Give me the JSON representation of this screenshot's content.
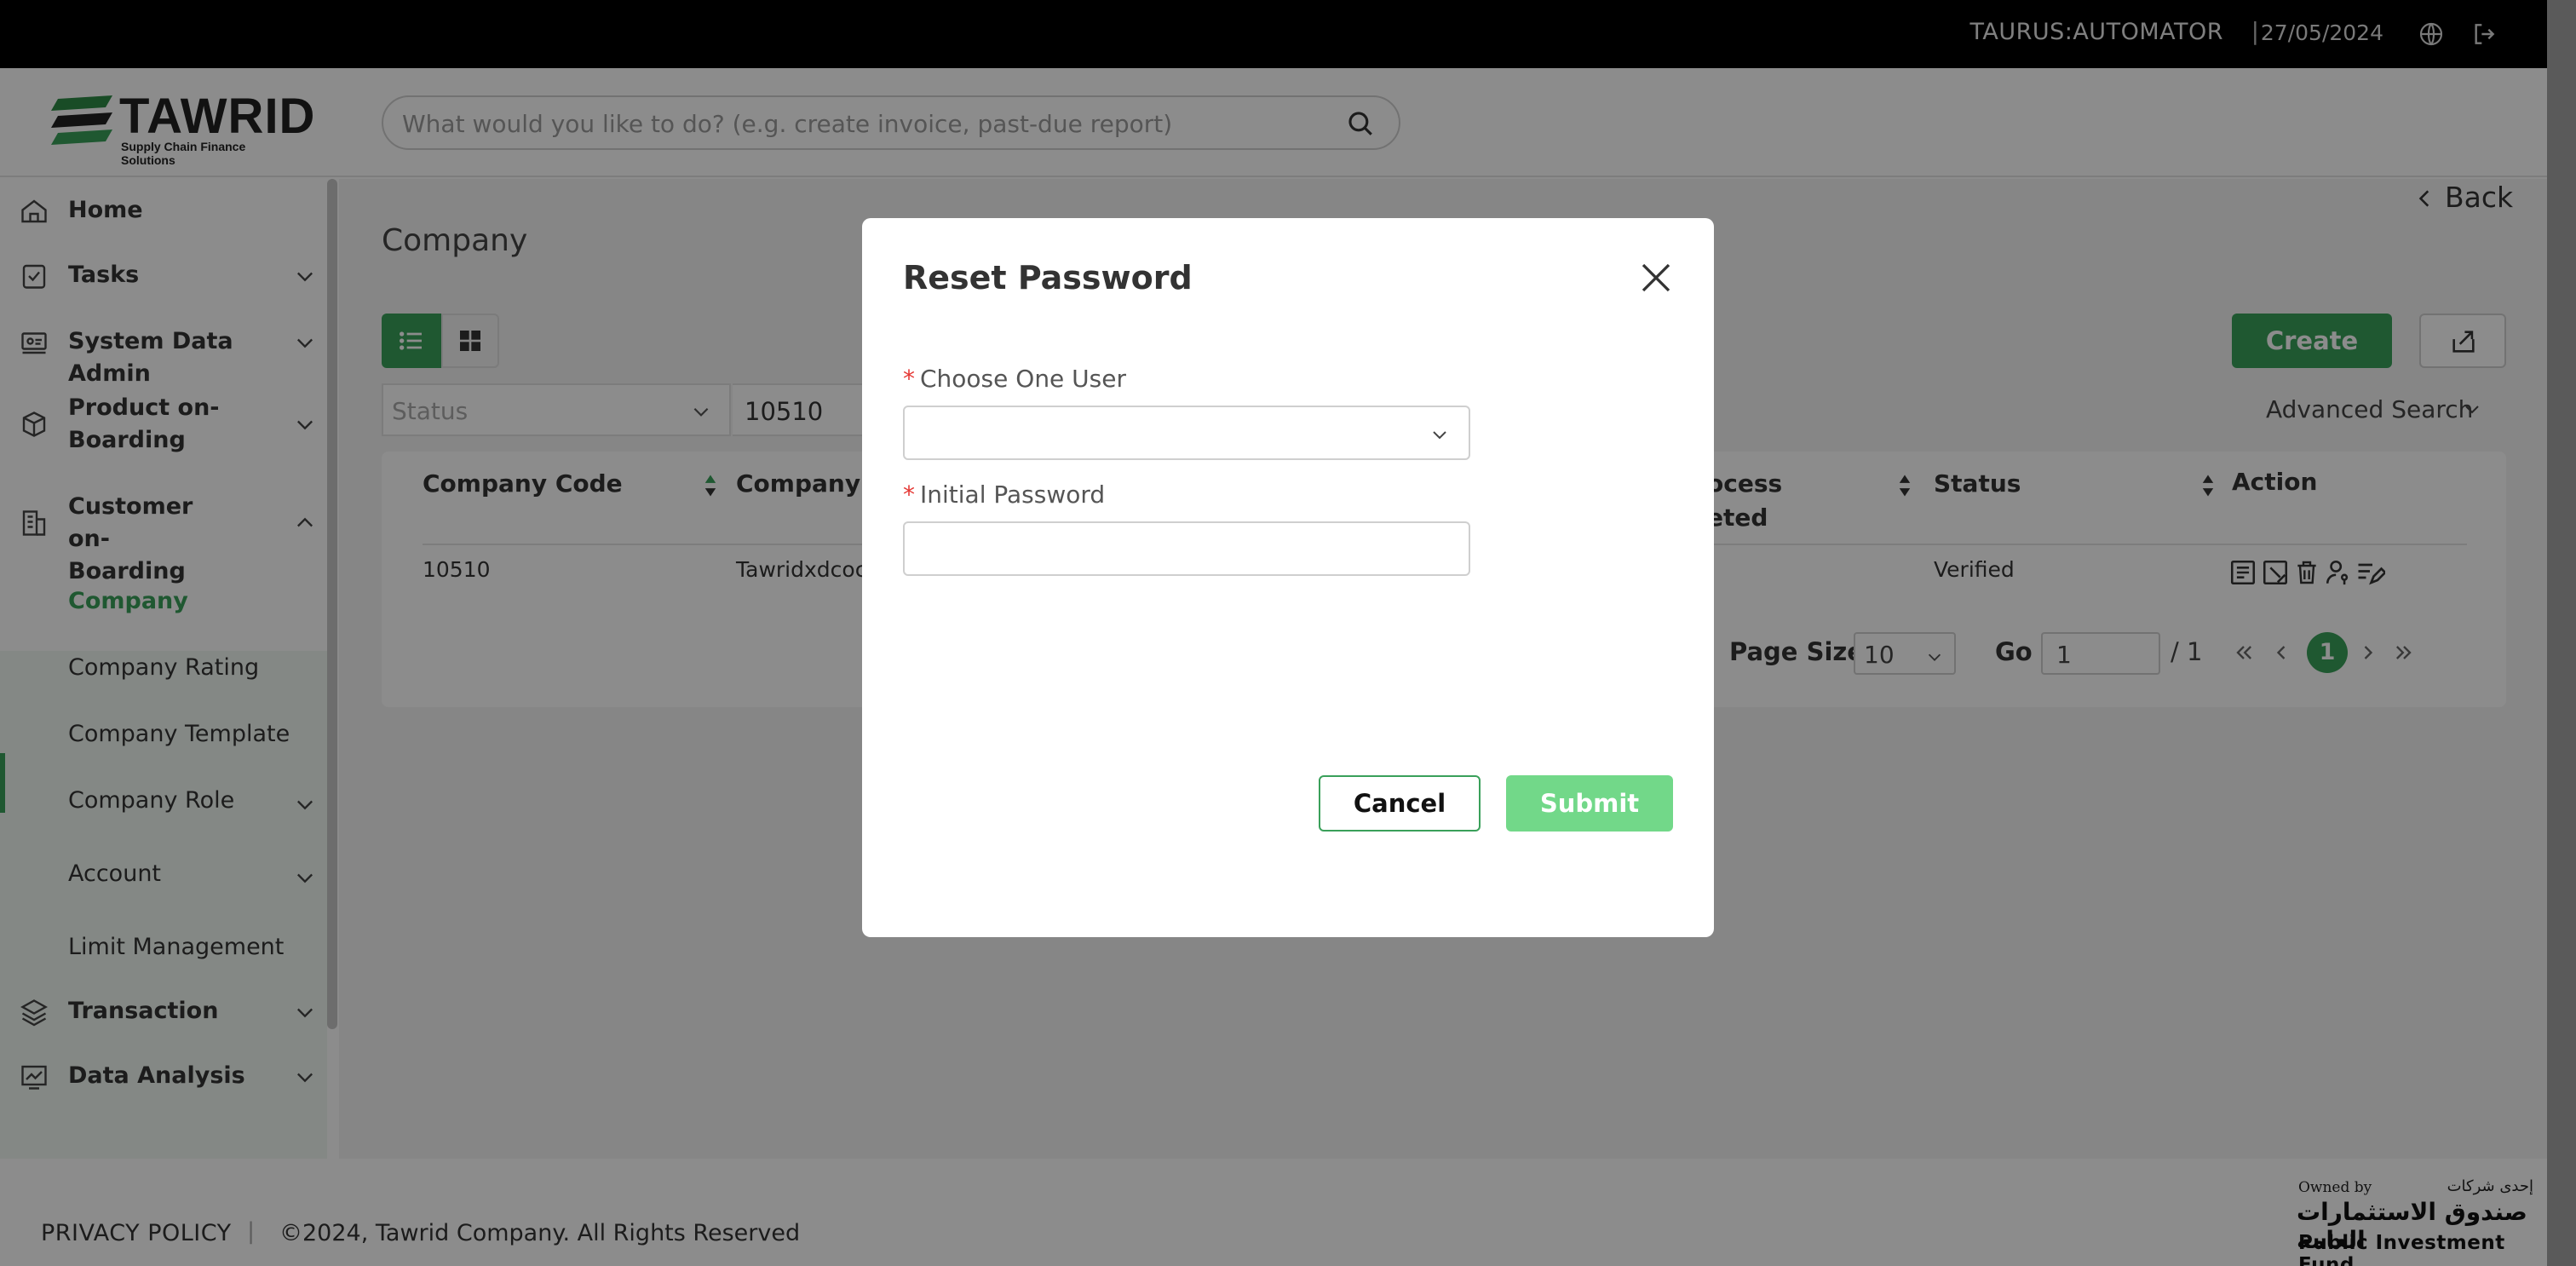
{
  "topbar": {
    "user": "TAURUS:AUTOMATOR",
    "separator": "|",
    "date": "27/05/2024"
  },
  "header": {
    "logo_text": "TAWRID",
    "logo_tagline": "Supply Chain Finance Solutions",
    "search_placeholder": "What would you like to do? (e.g. create invoice, past-due report)"
  },
  "sidebar": {
    "items": [
      {
        "label": "Home",
        "icon": "home-icon"
      },
      {
        "label": "Tasks",
        "icon": "tasks-icon"
      },
      {
        "label": "System Data Admin",
        "icon": "admin-icon"
      },
      {
        "label": "Product on-Boarding",
        "icon": "package-icon"
      },
      {
        "label": "Customer on-Boarding",
        "icon": "building-icon"
      },
      {
        "label": "Transaction",
        "icon": "layers-icon"
      },
      {
        "label": "Data Analysis",
        "icon": "chart-icon"
      }
    ],
    "subitems": [
      {
        "label": "Company",
        "active": true
      },
      {
        "label": "Company Rating"
      },
      {
        "label": "Company Template"
      },
      {
        "label": "Company Role"
      },
      {
        "label": "Account"
      },
      {
        "label": "Limit Management"
      }
    ]
  },
  "main": {
    "title": "Company",
    "back_label": "Back",
    "create_label": "Create",
    "status_placeholder": "Status",
    "code_filter_value": "10510",
    "advanced_search_label": "Advanced Search",
    "table": {
      "headers": [
        "Company Code",
        "Company N",
        "ocess\neted",
        "Status",
        "Action"
      ],
      "rows": [
        {
          "code": "10510",
          "name": "Tawridxdcocxo",
          "status": "Verified"
        }
      ]
    },
    "pager": {
      "page_size_label": "Page Size",
      "page_size_value": "10",
      "go_label": "Go",
      "go_value": "1",
      "total": "/ 1",
      "current": "1"
    }
  },
  "footer": {
    "privacy": "PRIVACY POLICY",
    "separator": "|",
    "copyright": "©2024, Tawrid Company. All Rights Reserved",
    "owned_by": "Owned by",
    "owned_by_ar": "إحدى شركات",
    "pif_ar": "صندوق الاستثمارات العامة",
    "pif_en": "Public Investment Fund"
  },
  "modal": {
    "title": "Reset Password",
    "field1_label": "Choose One User",
    "field2_label": "Initial Password",
    "required_mark": "*",
    "cancel_label": "Cancel",
    "submit_label": "Submit"
  },
  "colors": {
    "brand_green": "#3aa05a",
    "submit_disabled": "#72d889",
    "required": "#e53935"
  }
}
